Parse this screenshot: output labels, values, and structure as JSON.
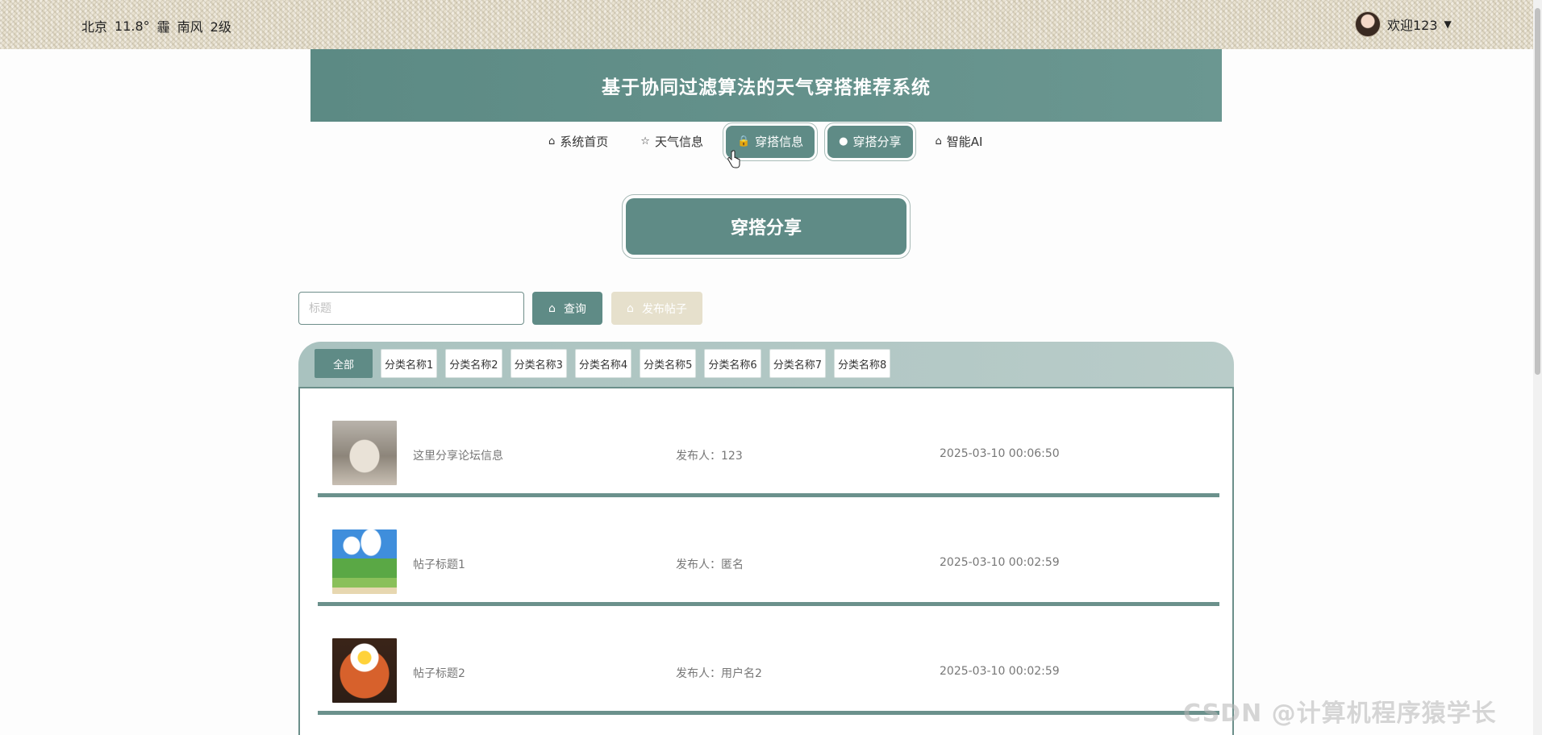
{
  "topbar": {
    "city": "北京",
    "temperature": "11.8°",
    "weather_icon": "霾",
    "wind_direction": "南风",
    "wind_level": "2级",
    "welcome": "欢迎123",
    "caret": "▼"
  },
  "banner": {
    "title": "基于协同过滤算法的天气穿搭推荐系统"
  },
  "nav": {
    "items": [
      {
        "label": "系统首页",
        "icon": "⌂"
      },
      {
        "label": "天气信息",
        "icon": "☆"
      },
      {
        "label": "穿搭信息",
        "icon": "🔒"
      },
      {
        "label": "穿搭分享",
        "icon": "●"
      },
      {
        "label": "智能AI",
        "icon": "⌂"
      }
    ]
  },
  "section": {
    "title": "穿搭分享"
  },
  "search": {
    "placeholder": "标题",
    "query_label": "查询",
    "publish_label": "发布帖子"
  },
  "categories": [
    "全部",
    "分类名称1",
    "分类名称2",
    "分类名称3",
    "分类名称4",
    "分类名称5",
    "分类名称6",
    "分类名称7",
    "分类名称8"
  ],
  "posts": [
    {
      "title": "这里分享论坛信息",
      "author": "发布人：123",
      "time": "2025-03-10 00:06:50"
    },
    {
      "title": "帖子标题1",
      "author": "发布人：匿名",
      "time": "2025-03-10 00:02:59"
    },
    {
      "title": "帖子标题2",
      "author": "发布人：用户名2",
      "time": "2025-03-10 00:02:59"
    }
  ],
  "watermark": "CSDN @计算机程序猿学长",
  "colors": {
    "primary": "#5f8b86",
    "banner": "#5c8a84",
    "publish": "#e6e0cc"
  }
}
